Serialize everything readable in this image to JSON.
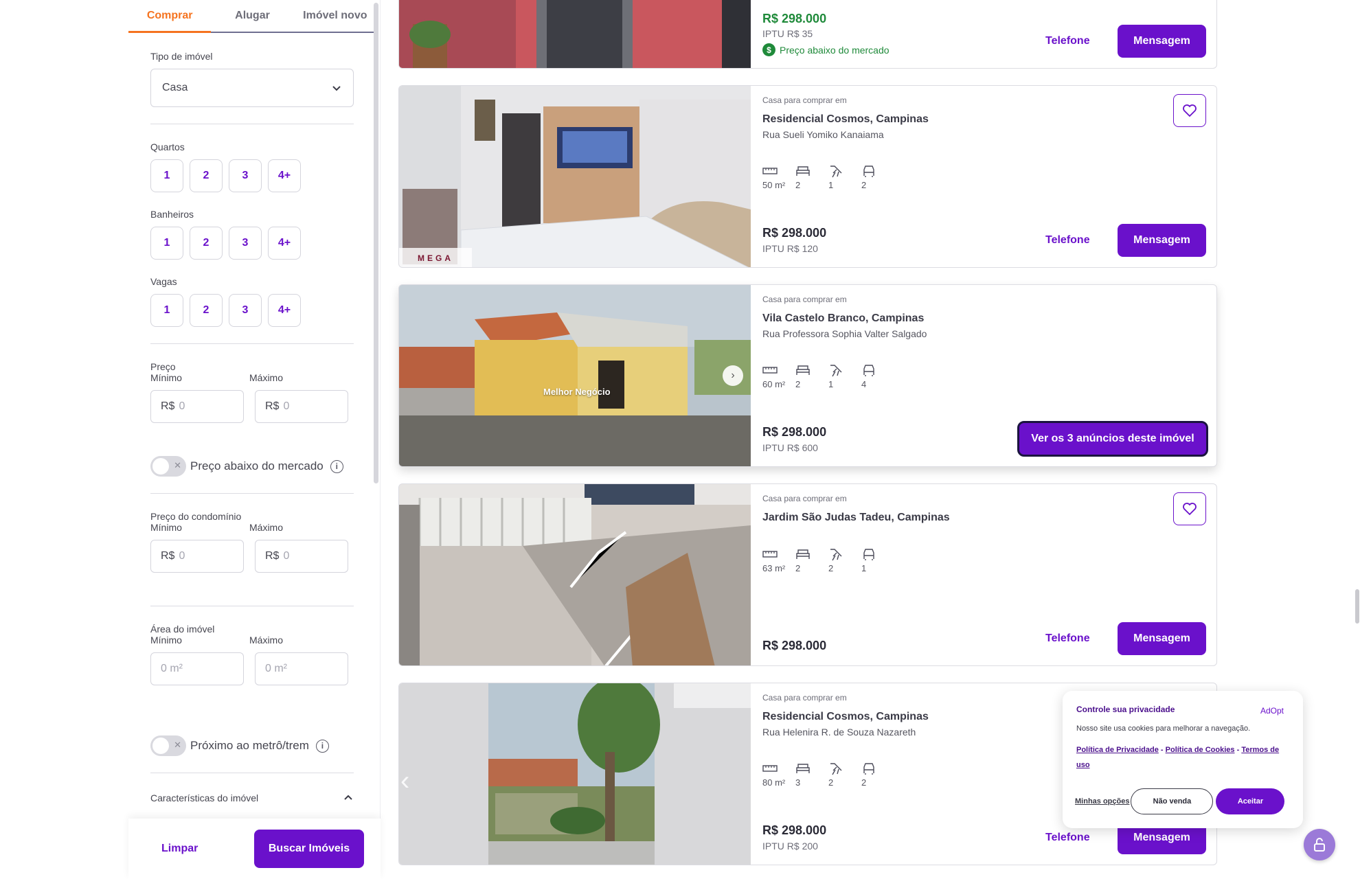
{
  "sidebar": {
    "tabs": [
      {
        "label": "Comprar"
      },
      {
        "label": "Alugar"
      },
      {
        "label": "Imóvel novo"
      }
    ],
    "property_type": {
      "label": "Tipo de imóvel",
      "value": "Casa"
    },
    "rooms": {
      "label": "Quartos",
      "options": [
        "1",
        "2",
        "3",
        "4+"
      ]
    },
    "bathrooms": {
      "label": "Banheiros",
      "options": [
        "1",
        "2",
        "3",
        "4+"
      ]
    },
    "parking": {
      "label": "Vagas",
      "options": [
        "1",
        "2",
        "3",
        "4+"
      ]
    },
    "price": {
      "label": "Preço",
      "min_label": "Mínimo",
      "max_label": "Máximo",
      "currency": "R$",
      "min_placeholder": "0",
      "max_placeholder": "0"
    },
    "below_market": {
      "label": "Preço abaixo do mercado",
      "enabled": false
    },
    "condo_price": {
      "label": "Preço do condomínio",
      "min_label": "Mínimo",
      "max_label": "Máximo",
      "currency": "R$",
      "min_placeholder": "0",
      "max_placeholder": "0"
    },
    "area": {
      "label": "Área do imóvel",
      "min_label": "Mínimo",
      "max_label": "Máximo",
      "min_placeholder": "0 m²",
      "max_placeholder": "0 m²"
    },
    "near_metro": {
      "label": "Próximo ao metrô/trem",
      "enabled": false
    },
    "features_label": "Características do imóvel",
    "clear_label": "Limpar",
    "search_label": "Buscar Imóveis"
  },
  "listings": [
    {
      "price": "R$ 298.000",
      "iptu": "IPTU R$ 35",
      "badge": "Preço abaixo do mercado",
      "phone_label": "Telefone",
      "message_label": "Mensagem"
    },
    {
      "context": "Casa para comprar em",
      "title": "Residencial Cosmos, Campinas",
      "street": "Rua Sueli Yomiko Kanaiama",
      "area": "50 m²",
      "bedrooms": "2",
      "bathrooms": "1",
      "parking": "2",
      "price": "R$ 298.000",
      "iptu": "IPTU R$ 120",
      "phone_label": "Telefone",
      "message_label": "Mensagem",
      "watermark": "MEGA"
    },
    {
      "context": "Casa para comprar em",
      "title": "Vila Castelo Branco, Campinas",
      "street": "Rua Professora Sophia Valter Salgado",
      "area": "60 m²",
      "bedrooms": "2",
      "bathrooms": "1",
      "parking": "4",
      "price": "R$ 298.000",
      "iptu": "IPTU R$ 600",
      "see_all_label": "Ver os 3 anúncios deste imóvel",
      "watermark": "Melhor Negócio"
    },
    {
      "context": "Casa para comprar em",
      "title": "Jardim São Judas Tadeu, Campinas",
      "area": "63 m²",
      "bedrooms": "2",
      "bathrooms": "2",
      "parking": "1",
      "price": "R$ 298.000",
      "phone_label": "Telefone",
      "message_label": "Mensagem"
    },
    {
      "context": "Casa para comprar em",
      "title": "Residencial Cosmos, Campinas",
      "street": "Rua Helenira R. de Souza Nazareth",
      "area": "80 m²",
      "bedrooms": "3",
      "bathrooms": "2",
      "parking": "2",
      "price": "R$ 298.000",
      "iptu": "IPTU R$ 200",
      "phone_label": "Telefone",
      "message_label": "Mensagem"
    }
  ],
  "cookie": {
    "title": "Controle sua privacidade",
    "brand": "AdOpt",
    "text": "Nosso site usa cookies para melhorar a navegação.",
    "privacy_link": "Política de Privacidade",
    "cookies_link": "Política de Cookies",
    "terms_link": "Termos de uso",
    "separator": "-",
    "options_label": "Minhas opções",
    "deny_label": "Não venda",
    "accept_label": "Aceitar"
  },
  "colors": {
    "accent": "#6a11cb",
    "tab_active": "#f5731f",
    "below_market": "#1f8a3a"
  },
  "icons": [
    "chevron-down-icon",
    "info-icon",
    "ruler-icon",
    "bed-icon",
    "shower-icon",
    "car-icon",
    "heart-icon",
    "dollar-icon",
    "lock-icon"
  ]
}
